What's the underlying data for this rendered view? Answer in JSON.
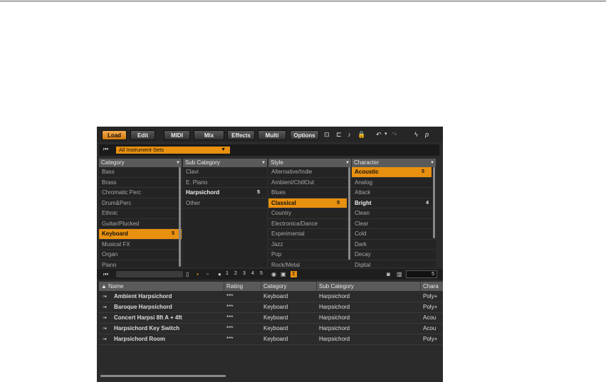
{
  "toolbar": {
    "tabs": [
      "Load",
      "Edit",
      "MIDI",
      "Mix",
      "Effects",
      "Multi",
      "Options"
    ],
    "active_tab": "Load",
    "accent": "#e8900f"
  },
  "instrument_set": {
    "selected": "All Instrument Sets"
  },
  "columns": {
    "category": {
      "header": "Category",
      "items": [
        {
          "label": "Bass",
          "count": ""
        },
        {
          "label": "Brass",
          "count": ""
        },
        {
          "label": "Chromatic Perc",
          "count": ""
        },
        {
          "label": "Drum&Perc",
          "count": ""
        },
        {
          "label": "Ethnic",
          "count": ""
        },
        {
          "label": "Guitar/Plucked",
          "count": ""
        },
        {
          "label": "Keyboard",
          "count": "5"
        },
        {
          "label": "Musical FX",
          "count": ""
        },
        {
          "label": "Organ",
          "count": ""
        },
        {
          "label": "Piano",
          "count": ""
        }
      ]
    },
    "sub_category": {
      "header": "Sub Category",
      "items": [
        {
          "label": "Clavi",
          "count": ""
        },
        {
          "label": "E. Piano",
          "count": ""
        },
        {
          "label": "Harpsichord",
          "count": "5"
        },
        {
          "label": "Other",
          "count": ""
        }
      ]
    },
    "style": {
      "header": "Style",
      "items": [
        {
          "label": "Alternative/Indie",
          "count": ""
        },
        {
          "label": "Ambient/ChillOut",
          "count": ""
        },
        {
          "label": "Blues",
          "count": ""
        },
        {
          "label": "Classical",
          "count": "5"
        },
        {
          "label": "Country",
          "count": ""
        },
        {
          "label": "Electronica/Dance",
          "count": ""
        },
        {
          "label": "Experimental",
          "count": ""
        },
        {
          "label": "Jazz",
          "count": ""
        },
        {
          "label": "Pop",
          "count": ""
        },
        {
          "label": "Rock/Metal",
          "count": ""
        }
      ]
    },
    "character": {
      "header": "Character",
      "items": [
        {
          "label": "Acoustic",
          "count": "5"
        },
        {
          "label": "Analog",
          "count": ""
        },
        {
          "label": "Attack",
          "count": ""
        },
        {
          "label": "Bright",
          "count": "4"
        },
        {
          "label": "Clean",
          "count": ""
        },
        {
          "label": "Clear",
          "count": ""
        },
        {
          "label": "Cold",
          "count": ""
        },
        {
          "label": "Dark",
          "count": ""
        },
        {
          "label": "Decay",
          "count": ""
        },
        {
          "label": "Digital",
          "count": ""
        }
      ]
    }
  },
  "filter_bar": {
    "ratings": [
      "1",
      "2",
      "3",
      "4",
      "5"
    ],
    "sigma": "Σ",
    "result_count": "5"
  },
  "results": {
    "headers": [
      "Name",
      "Rating",
      "Category",
      "Sub Category",
      "Chara"
    ],
    "rows": [
      {
        "name": "Ambient Harpsichord",
        "rating": "***",
        "category": "Keyboard",
        "sub": "Harpsichord",
        "char": "Poly+"
      },
      {
        "name": "Baroque Harpsichord",
        "rating": "***",
        "category": "Keyboard",
        "sub": "Harpsichord",
        "char": "Poly+"
      },
      {
        "name": "Concert Harpsi 8ft A + 4ft",
        "rating": "***",
        "category": "Keyboard",
        "sub": "Harpsichord",
        "char": "Acou"
      },
      {
        "name": "Harpsichord Key Switch",
        "rating": "***",
        "category": "Keyboard",
        "sub": "Harpsichord",
        "char": "Acou"
      },
      {
        "name": "Harpsichord Room",
        "rating": "***",
        "category": "Keyboard",
        "sub": "Harpsichord",
        "char": "Poly+"
      }
    ]
  }
}
